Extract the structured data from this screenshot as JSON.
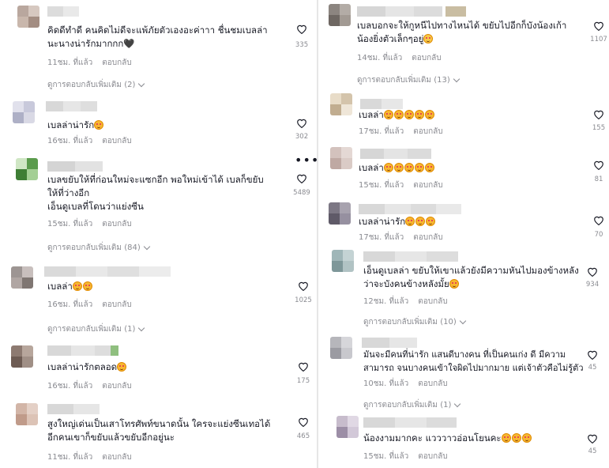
{
  "left_column": [
    {
      "text": "คิดดีทำดี คนคิดไม่ดีจะแพ้ภัยตัวเองอะค่าาา ชื่นชมเบลล่า\nนะนางน่ารักมากกก",
      "trailing": "🖤",
      "time": "11ชม. ที่แล้ว",
      "reply": "ตอบกลับ",
      "likes": "335",
      "view_replies": "ดูการตอบกลับเพิ่มเติม (2)"
    },
    {
      "text": "เบลล่าน่ารัก",
      "emoji_count": 1,
      "time": "16ชม. ที่แล้ว",
      "reply": "ตอบกลับ",
      "likes": "302"
    },
    {
      "text": "เบลขยับให้ที่ก่อนใหม่จะแซกอีก พอใหม่เข้าได้ เบลก็ขยับ\nให้ที่ว่างอีก\nเอ็นดูเบลที่โดนว่าแย่งซีน",
      "time": "15ชม. ที่แล้ว",
      "reply": "ตอบกลับ",
      "likes": "5489",
      "view_replies": "ดูการตอบกลับเพิ่มเติม (84)"
    },
    {
      "text": "เบลล่า",
      "emoji_count": 2,
      "time": "16ชม. ที่แล้ว",
      "reply": "ตอบกลับ",
      "likes": "1025",
      "view_replies": "ดูการตอบกลับเพิ่มเติม (1)"
    },
    {
      "text": "เบลล่าน่ารักตลอด",
      "emoji_count": 1,
      "time": "16ชม. ที่แล้ว",
      "reply": "ตอบกลับ",
      "likes": "175"
    },
    {
      "text": "สูงใหญ่เด่นเป็นเสาโทรศัพท์ขนาดนั้น ใครจะแย่งซีนเทอได้\nอีกคนเขาก็ขยับแล้วขยับอีกอยู่นะ",
      "time": "11ชม. ที่แล้ว",
      "reply": "ตอบกลับ",
      "likes": "465"
    }
  ],
  "right_column": [
    {
      "text": "เบลบอกจะให้กูหนีไปทางไหนได้ ขยับไปอีกก็บังน้องเก้า\nน้องยิ่งตัวเล็กๆอยู่",
      "trailing_laugh": true,
      "time": "14ชม. ที่แล้ว",
      "reply": "ตอบกลับ",
      "likes": "1107",
      "view_replies": "ดูการตอบกลับเพิ่มเติม (13)"
    },
    {
      "text": "เบลล่า",
      "emoji_count": 5,
      "time": "17ชม. ที่แล้ว",
      "reply": "ตอบกลับ",
      "likes": "155"
    },
    {
      "text": "เบลล่า",
      "emoji_count": 5,
      "time": "15ชม. ที่แล้ว",
      "reply": "ตอบกลับ",
      "likes": "81"
    },
    {
      "text": "เบลล่าน่ารัก",
      "emoji_count": 3,
      "time": "17ชม. ที่แล้ว",
      "reply": "ตอบกลับ",
      "likes": "70"
    },
    {
      "text": "เอ็นดูเบลล่า ขยับให้เขาแล้วยังมีความหันไปมองข้างหลัง\nว่าจะบังคนข้างหลังมั้ย",
      "emoji_count": 1,
      "time": "12ชม. ที่แล้ว",
      "reply": "ตอบกลับ",
      "likes": "934",
      "view_replies": "ดูการตอบกลับเพิ่มเติม (10)"
    },
    {
      "text": "มันจะมีคนที่น่ารัก แสนดีบางคน ที่เป็นคนเก่ง ดี มีความ\nสามารถ จนบางคนเข้าใจผิดไปมากมาย แต่เจ้าตัวคือไม่รู้ตัว",
      "time": "10ชม. ที่แล้ว",
      "reply": "ตอบกลับ",
      "likes": "45",
      "view_replies": "ดูการตอบกลับเพิ่มเติม (1)"
    },
    {
      "text": "น้องงามมากคะ แวววาวอ่อนโยนคะ",
      "emoji_count": 3,
      "time": "15ชม. ที่แล้ว",
      "reply": "ตอบกลับ",
      "likes": "45"
    }
  ],
  "icons": {
    "heart": "heart-outline-icon",
    "more": "more-options-icon",
    "chevron": "chevron-down-icon",
    "emoji": "smiling-face-with-heart-eyes-icon"
  }
}
